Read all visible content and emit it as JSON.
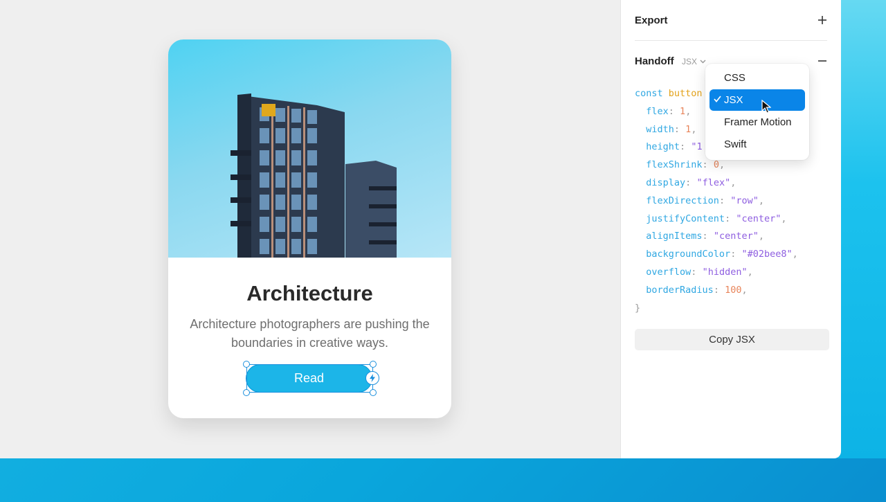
{
  "card": {
    "title": "Architecture",
    "description": "Architecture photographers are pushing the boundaries in creative ways.",
    "button_label": "Read"
  },
  "panel": {
    "export_title": "Export",
    "handoff_title": "Handoff",
    "format_selected": "JSX",
    "copy_button": "Copy JSX"
  },
  "code": {
    "line0_kw": "const",
    "line0_var": "button",
    "props": [
      {
        "key": "flex",
        "value": "1"
      },
      {
        "key": "width",
        "value": "1"
      },
      {
        "key": "height",
        "value": "\"1"
      },
      {
        "key": "flexShrink",
        "value": "0"
      },
      {
        "key": "display",
        "value": "\"flex\""
      },
      {
        "key": "flexDirection",
        "value": "\"row\""
      },
      {
        "key": "justifyContent",
        "value": "\"center\""
      },
      {
        "key": "alignItems",
        "value": "\"center\""
      },
      {
        "key": "backgroundColor",
        "value": "\"#02bee8\""
      },
      {
        "key": "overflow",
        "value": "\"hidden\""
      },
      {
        "key": "borderRadius",
        "value": "100"
      }
    ],
    "closing": "}"
  },
  "dropdown": {
    "options": [
      "CSS",
      "JSX",
      "Framer Motion",
      "Swift"
    ],
    "selected": "JSX"
  },
  "colors": {
    "accent": "#0a85e8",
    "button": "#1cb5e8",
    "code_key": "#2fa7e2",
    "code_string": "#8e5ee0",
    "code_number": "#e8845a"
  }
}
